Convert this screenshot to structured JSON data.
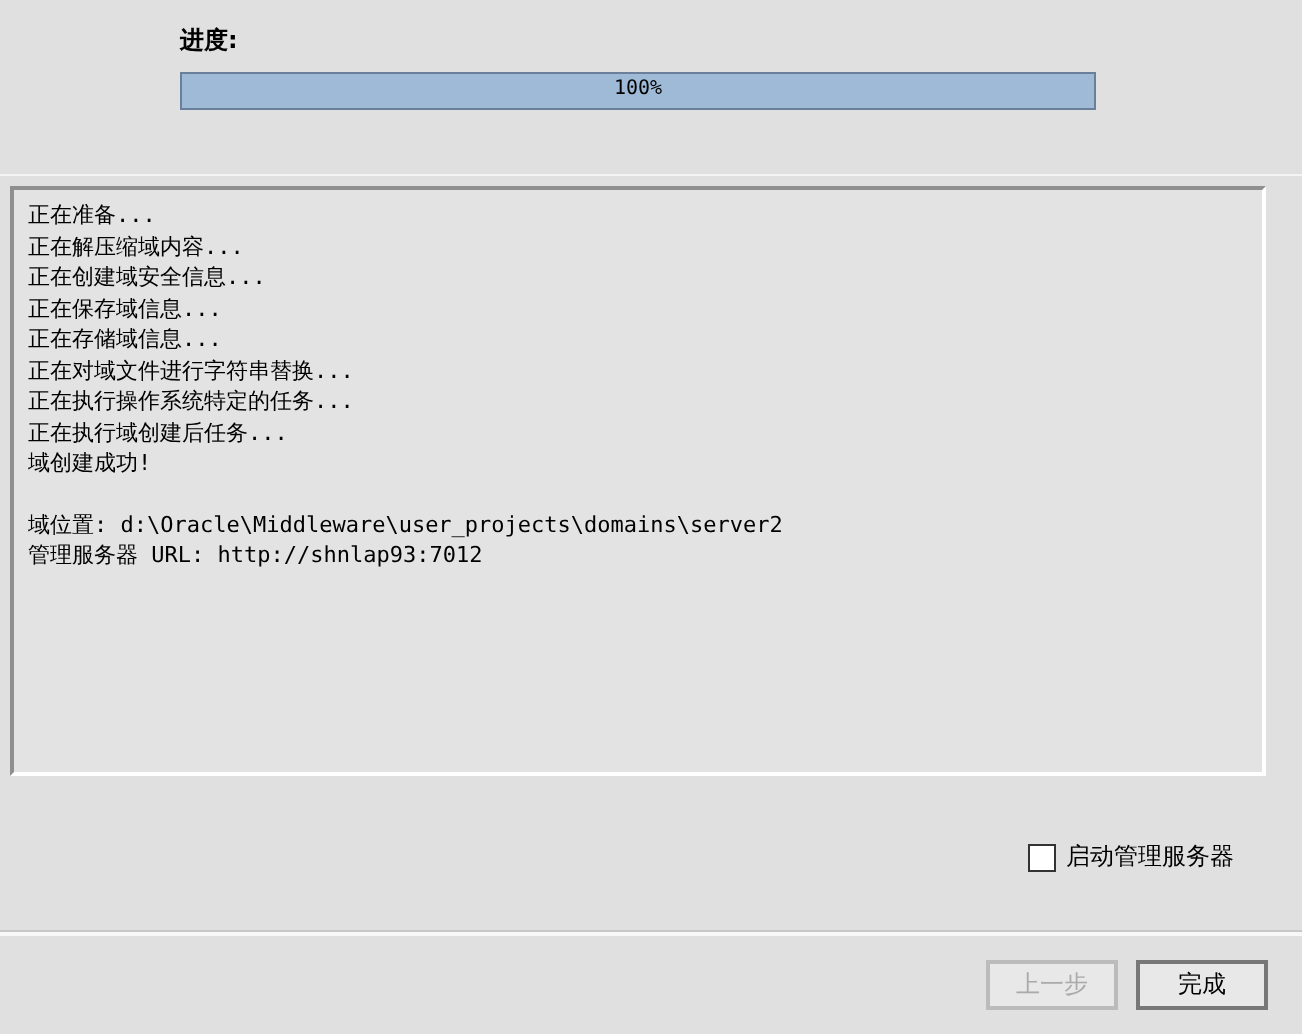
{
  "progress": {
    "label": "进度:",
    "level": 1,
    "reading": "100%"
  },
  "log": {
    "lines": [
      "正在准备...",
      "正在解压缩域内容...",
      "正在创建域安全信息...",
      "正在保存域信息...",
      "正在存储域信息...",
      "正在对域文件进行字符串替换...",
      "正在执行操作系统特定的任务...",
      "正在执行域创建后任务...",
      "域创建成功!"
    ],
    "summary": [
      "域位置: d:\\Oracle\\Middleware\\user_projects\\domains\\server2",
      "管理服务器 URL: http://shnlap93:7012"
    ]
  },
  "start_admin_server": {
    "label": "启动管理服务器",
    "checked": false
  },
  "buttons": [
    {
      "label": "上一步",
      "disabled": true
    },
    {
      "label": "完成",
      "disabled": false
    }
  ]
}
